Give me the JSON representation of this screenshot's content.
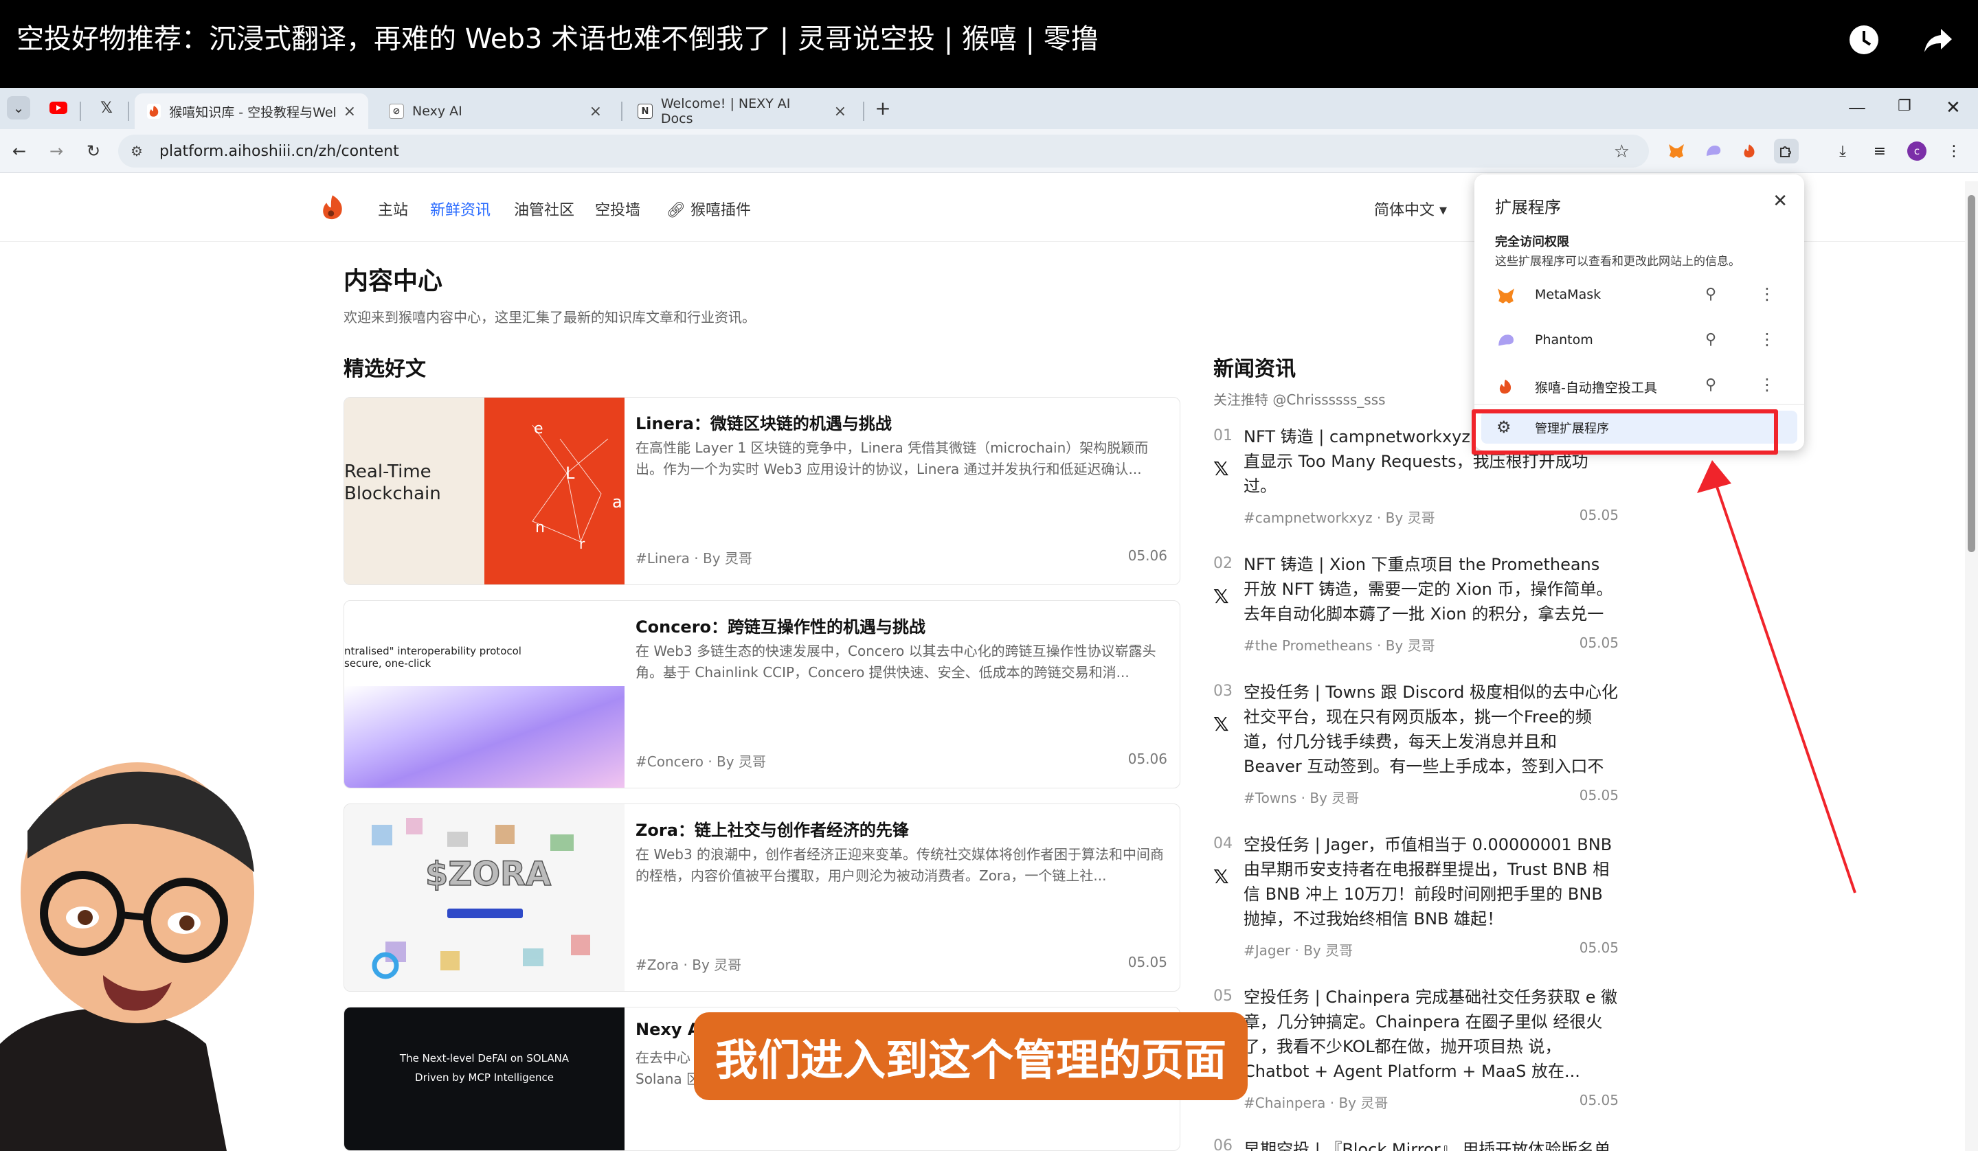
{
  "video": {
    "title": "空投好物推荐：沉浸式翻译，再难的 Web3 术语也难不倒我了 | 灵哥说空投 | 猴嘻 | 零撸",
    "icons": [
      "clock-icon",
      "share-icon"
    ]
  },
  "browser": {
    "tabs": [
      {
        "label": "猴嘻知识库 - 空投教程与Web3",
        "favicon": "houxi-logo-icon",
        "active": true
      },
      {
        "label": "Nexy AI",
        "favicon": "nexy-icon",
        "active": false
      },
      {
        "label": "Welcome! | NEXY AI Docs",
        "favicon": "notion-icon",
        "active": false
      }
    ],
    "new_tab": "+",
    "url": "platform.aihoshiii.cn/zh/content"
  },
  "site": {
    "nav": [
      "主站",
      "新鲜资讯",
      "油管社区",
      "空投墙",
      "猴嘻插件"
    ],
    "active_nav": "新鲜资讯",
    "language": "简体中文"
  },
  "content": {
    "title": "内容中心",
    "subtitle": "欢迎来到猴嘻内容中心，这里汇集了最新的知识库文章和行业资讯。",
    "featured_heading": "精选好文",
    "news_heading": "新闻资讯",
    "news_follow": "关注推特 @Chrissssss_sss"
  },
  "articles": [
    {
      "title": "Linera：微链区块链的机遇与挑战",
      "excerpt": "在高性能 Layer 1 区块链的竞争中，Linera 凭借其微链（microchain）架构脱颖而出。作为一个为实时 Web3 应用设计的协议，Linera 通过并发执行和低延迟确认...",
      "tag": "#Linera",
      "author": "· By 灵哥",
      "date": "05.06",
      "thumb_text": "Real-Time\nBlockchain"
    },
    {
      "title": "Concero：跨链互操作性的机遇与挑战",
      "excerpt": "在 Web3 多链生态的快速发展中，Concero 以其去中心化的跨链互操作性协议崭露头角。基于 Chainlink CCIP，Concero 提供快速、安全、低成本的跨链交易和消...",
      "tag": "#Concero",
      "author": "· By 灵哥",
      "date": "05.06",
      "thumb_text": "ntralised\" interoperability protocol\nsecure, one-click"
    },
    {
      "title": "Zora：链上社交与创作者经济的先锋",
      "excerpt": "在 Web3 的浪潮中，创作者经济正迎来变革。传统社交媒体将创作者困于算法和中间商的桎梏，内容价值被平台攫取，用户则沦为被动消费者。Zora，一个链上社...",
      "tag": "#Zora",
      "author": "· By 灵哥",
      "date": "05.05",
      "thumb_text": "$ZORA"
    },
    {
      "title": "Nexy AI",
      "excerpt": "在去中心",
      "excerpt2": "Solana 区",
      "tag": "",
      "author": "",
      "date": "",
      "thumb_text": "The Next-level DeFAI on SOLANA\nDriven by MCP Intelligence"
    }
  ],
  "news": [
    {
      "num": "01",
      "text": "NFT 铸造 | campnetworkxyz 限 上午试了几次一直显示 Too Many Requests，我压根打开成功过。",
      "tag": "#campnetworkxyz · By 灵哥",
      "date": "05.05"
    },
    {
      "num": "02",
      "text": "NFT 铸造 | Xion 下重点项目 the Prometheans 开放 NFT 铸造，需要一定的 Xion 币，操作简单。去年自动化脚本薅了一批 Xion 的积分，拿去兑一兑。",
      "tag": "#the Prometheans · By 灵哥",
      "date": "05.05"
    },
    {
      "num": "03",
      "text": "空投任务 | Towns 跟 Discord 极度相似的去中心化社交平台，现在只有网页版本，挑一个Free的频道，付几分钱手续费，每天上发消息并且和 Beaver 互动签到。有一些上手成本，签到入口不够清晰...",
      "tag": "#Towns · By 灵哥",
      "date": "05.05"
    },
    {
      "num": "04",
      "text": "空投任务 | Jager，币值相当于 0.00000001 BNB 由早期币安支持者在电报群里提出，Trust BNB 相信 BNB 冲上 10万刀！前段时间刚把手里的 BNB 抛掉，不过我始终相信 BNB 雄起！",
      "tag": "#Jager · By 灵哥",
      "date": "05.05"
    },
    {
      "num": "05",
      "text": "空投任务 | Chainpera 完成基础社交任务获取 e 徽章，几分钟搞定。Chainpera 在圈子里似 经很火了，我看不少KOL都在做，抛开项目热 说，Chatbot + Agent Platform + MaaS 放在...",
      "tag": "#Chainpera · By 灵哥",
      "date": "05.05"
    },
    {
      "num": "06",
      "text": "早期空投 | 『Block Mirror』 用插开放体验版名单进",
      "tag": "",
      "date": ""
    }
  ],
  "extensions_popup": {
    "title": "扩展程序",
    "section_title": "完全访问权限",
    "section_desc": "这些扩展程序可以查看和更改此网站上的信息。",
    "items": [
      {
        "name": "MetaMask",
        "icon": "metamask-fox-icon",
        "color": "#f6851b"
      },
      {
        "name": "Phantom",
        "icon": "phantom-ghost-icon",
        "color": "#ab9ff2"
      },
      {
        "name": "猴嘻-自动撸空投工具",
        "icon": "houxi-logo-icon",
        "color": "#e8501e"
      }
    ],
    "manage_label": "管理扩展程序"
  },
  "caption": "我们进入到这个管理的页面",
  "colors": {
    "accent_blue": "#2b6cff",
    "highlight_red": "#f0242b",
    "caption_orange": "#e16b1f",
    "linera_red": "#e8401c"
  }
}
